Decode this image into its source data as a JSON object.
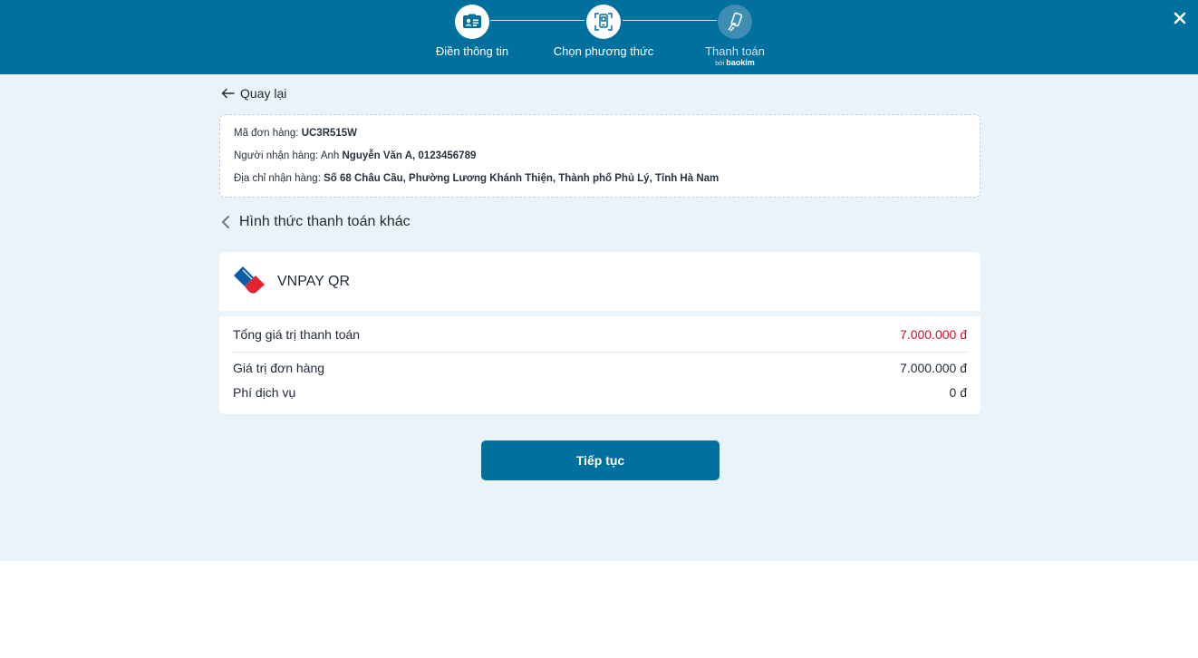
{
  "stepper": {
    "steps": [
      {
        "label": "Điền thông tin",
        "icon": "id-card-icon"
      },
      {
        "label": "Chọn phương thức",
        "icon": "phone-payment-icon"
      },
      {
        "label": "Thanh toán",
        "icon": "hand-phone-icon",
        "by_prefix": "bởi",
        "by_brand": "baokim"
      }
    ],
    "current_step": 2
  },
  "back": {
    "label": "Quay lại"
  },
  "order": {
    "code_label": "Mã đơn hàng:",
    "code": "UC3R515W",
    "recipient_label": "Người nhận hàng:",
    "recipient_prefix": "Anh",
    "recipient": "Nguyễn Văn A, 0123456789",
    "address_label": "Địa chỉ nhận hàng:",
    "address": "Số 68 Châu Cầu, Phường Lương Khánh Thiện, Thành phố Phủ Lý, Tỉnh Hà Nam"
  },
  "section": {
    "title": "Hình thức thanh toán khác"
  },
  "payment_method": {
    "name": "VNPAY QR",
    "icon": "vnpay-logo-icon"
  },
  "summary": {
    "total_label": "Tổng giá trị thanh toán",
    "total_value": "7.000.000 đ",
    "order_value_label": "Giá trị đơn hàng",
    "order_value": "7.000.000 đ",
    "fee_label": "Phí dịch vụ",
    "fee_value": "0 đ"
  },
  "continue_button": {
    "label": "Tiếp tục"
  },
  "colors": {
    "primary": "#00709e",
    "background": "#eaf3f9",
    "total_highlight": "#c8102e"
  }
}
